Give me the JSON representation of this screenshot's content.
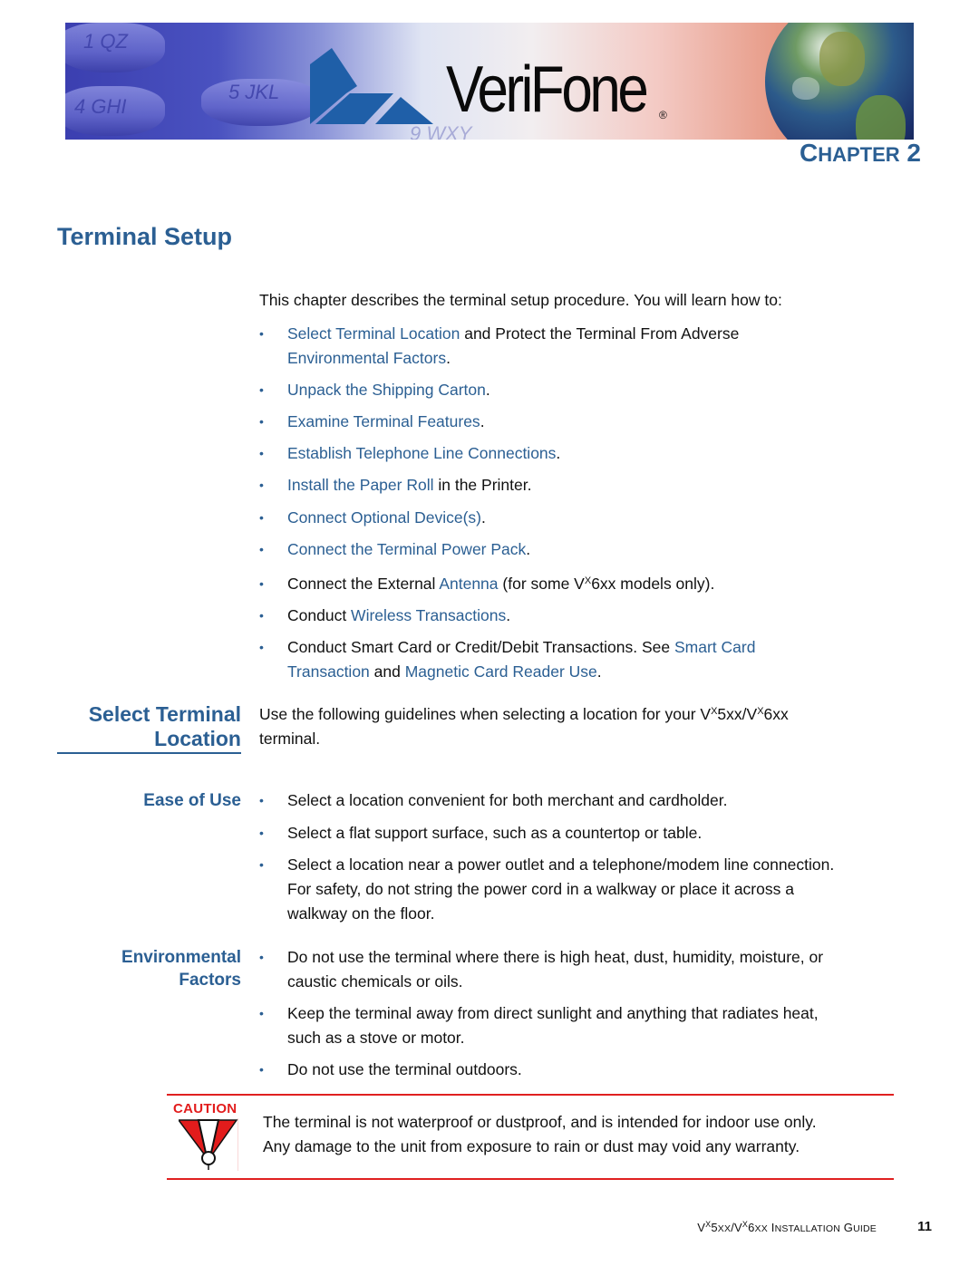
{
  "header": {
    "brand": "VeriFone",
    "registered_mark": "®",
    "keypad_labels": [
      "1 QZ",
      "4 GHI",
      "5 JKL",
      "9 WXY"
    ],
    "chapter_label_first": "C",
    "chapter_label_rest": "HAPTER",
    "chapter_number": "2"
  },
  "title": "Terminal Setup",
  "intro": "This chapter describes the terminal setup procedure. You will learn how to:",
  "toc": [
    {
      "link": "Select Terminal Location",
      "text": " and Protect the Terminal From Adverse",
      "link2": "Environmental Factors",
      "tail": "."
    },
    {
      "link": "Unpack the Shipping Carton",
      "tail": "."
    },
    {
      "link": "Examine Terminal Features",
      "tail": "."
    },
    {
      "link": "Establish Telephone Line Connections",
      "tail": "."
    },
    {
      "link": "Install the Paper Roll",
      "tail": " in the Printer."
    },
    {
      "link": "Connect Optional Device(s)",
      "tail": "."
    },
    {
      "link": "Connect the Terminal Power Pack",
      "tail": "."
    },
    {
      "pre": "Connect the External ",
      "link": "Antenna",
      "mid": " (for some V",
      "sup": "X",
      "tail": "6xx models only)."
    },
    {
      "pre": "Conduct ",
      "link": "Wireless Transactions",
      "tail": "."
    },
    {
      "pre": "Conduct Smart Card or Credit/Debit Transactions. See ",
      "link": "Smart Card",
      "link_line2": "Transaction",
      "mid": " and ",
      "link2": "Magnetic Card Reader Use",
      "tail": "."
    }
  ],
  "section": {
    "heading_line1": "Select Terminal",
    "heading_line2": "Location",
    "intro_pre": "Use the following guidelines when selecting a location for your V",
    "sup1": "X",
    "intro_mid": "5xx/V",
    "sup2": "X",
    "intro_post": "6xx",
    "intro_line2": "terminal."
  },
  "ease_of_use": {
    "heading": "Ease of Use",
    "items": [
      "Select a location convenient for both merchant and cardholder.",
      "Select a flat support surface, such as a countertop or table.",
      "Select a location near a power outlet and a telephone/modem line connection.",
      "For safety, do not string the power cord in a walkway or place it across a",
      "walkway on the floor."
    ]
  },
  "environmental": {
    "heading_line1": "Environmental",
    "heading_line2": "Factors",
    "items": [
      "Do not use the terminal where there is high heat, dust, humidity, moisture, or",
      "caustic chemicals or oils.",
      "Keep the terminal away from direct sunlight and anything that radiates heat,",
      "such as a stove or motor.",
      "Do not use the terminal outdoors."
    ]
  },
  "caution": {
    "label": "CAUTION",
    "line1": "The terminal is not waterproof or dustproof, and is intended for indoor use only.",
    "line2": "Any damage to the unit from exposure to rain or dust may void any warranty."
  },
  "footer": {
    "v1": "V",
    "sup1": "X",
    "mid1": "5",
    "xx1": "XX",
    "slash": "/V",
    "sup2": "X",
    "mid2": "6",
    "xx2": "XX",
    "I": " I",
    "nstallation": "NSTALLATION",
    "G": " G",
    "uide": "UIDE",
    "page_number": "11"
  },
  "colors": {
    "accent": "#2b5f93",
    "caution_red": "#e21c1c"
  }
}
